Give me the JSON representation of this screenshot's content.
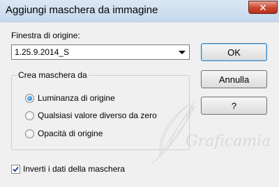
{
  "window": {
    "title": "Aggiungi maschera da immagine",
    "close_icon": "close-icon"
  },
  "source": {
    "label": "Finestra di origine:",
    "selected": "1.25.9.2014_S"
  },
  "buttons": {
    "ok": "OK",
    "cancel": "Annulla",
    "help": "?"
  },
  "mask_group": {
    "legend": "Crea maschera da",
    "options": [
      {
        "label": "Luminanza di origine",
        "selected": true
      },
      {
        "label": "Qualsiasi valore diverso da zero",
        "selected": false
      },
      {
        "label": "Opacità di origine",
        "selected": false
      }
    ]
  },
  "invert": {
    "label": "Inverti i dati della maschera",
    "checked": true
  },
  "watermark": {
    "text": "Graficamia",
    "icon": "feather-watermark-icon"
  }
}
